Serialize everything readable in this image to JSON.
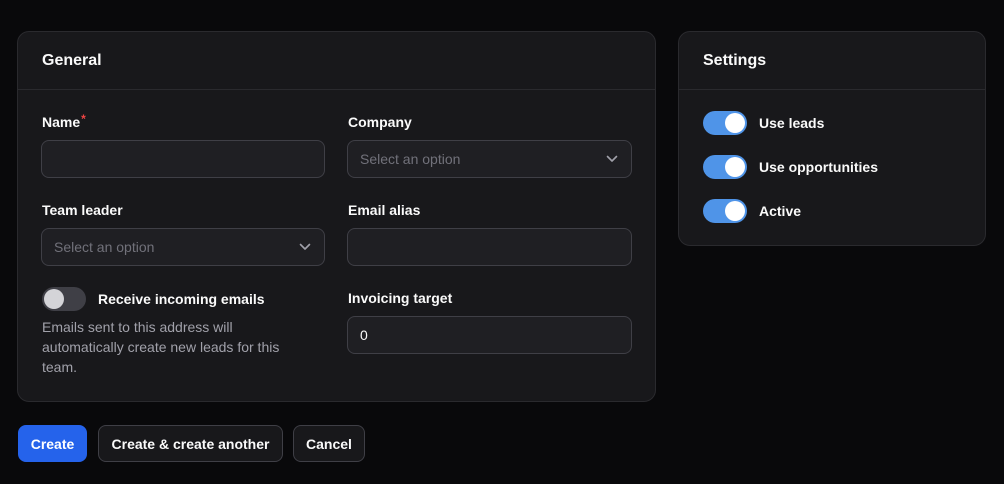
{
  "general": {
    "title": "General",
    "name": {
      "label": "Name",
      "required": "*",
      "value": ""
    },
    "company": {
      "label": "Company",
      "placeholder": "Select an option"
    },
    "team_leader": {
      "label": "Team leader",
      "placeholder": "Select an option"
    },
    "email_alias": {
      "label": "Email alias",
      "value": ""
    },
    "receive_emails": {
      "label": "Receive incoming emails",
      "enabled": false,
      "helper": "Emails sent to this address will automatically create new leads for this team."
    },
    "invoicing_target": {
      "label": "Invoicing target",
      "value": "0"
    }
  },
  "settings": {
    "title": "Settings",
    "toggles": [
      {
        "label": "Use leads",
        "enabled": true
      },
      {
        "label": "Use opportunities",
        "enabled": true
      },
      {
        "label": "Active",
        "enabled": true
      }
    ]
  },
  "actions": {
    "create": "Create",
    "create_another": "Create & create another",
    "cancel": "Cancel"
  },
  "colors": {
    "accent": "#2563eb",
    "toggle_on": "#4f94e8",
    "required": "#ef4444"
  }
}
